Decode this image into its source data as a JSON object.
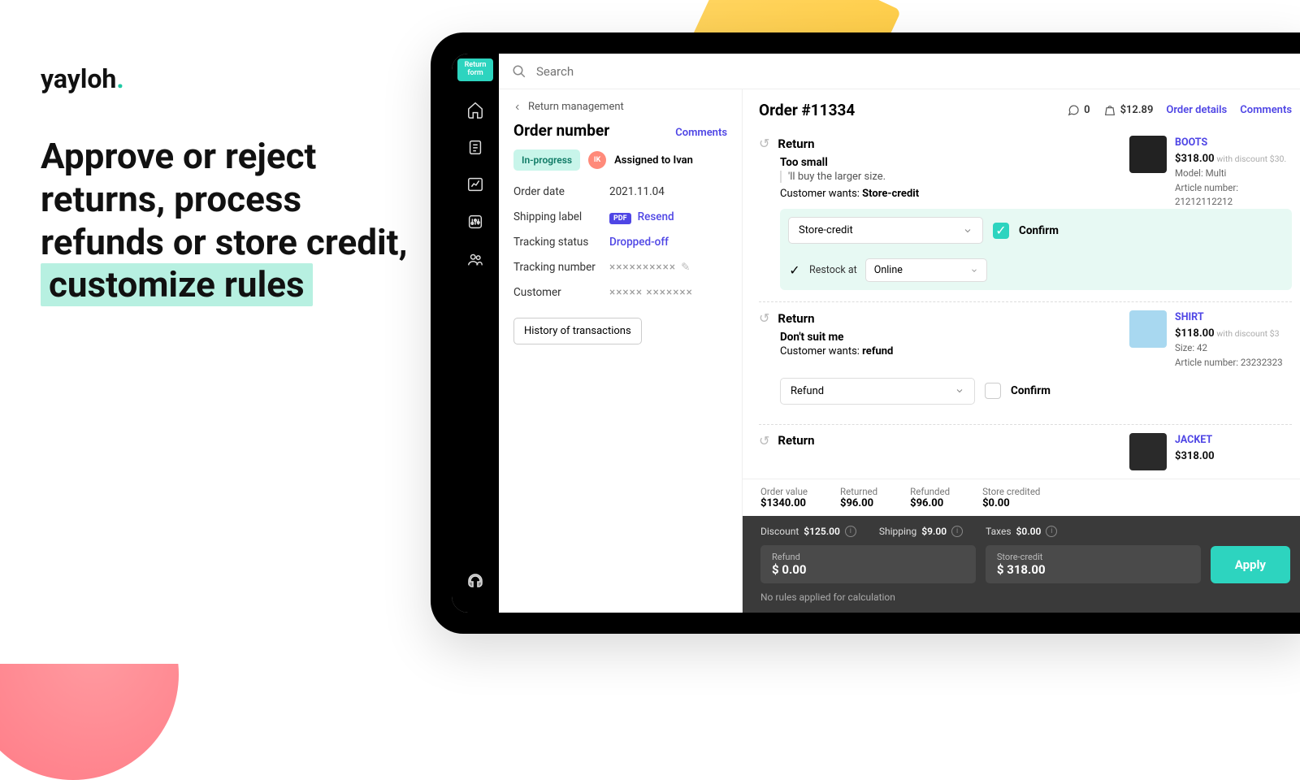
{
  "hero": {
    "brand": "yayloh",
    "tagline_part1": "Approve or reject returns, process refunds or store credit, ",
    "tagline_highlight": "customize rules"
  },
  "sidebar": {
    "return_form_label": "Return form"
  },
  "search": {
    "placeholder": "Search"
  },
  "left_panel": {
    "breadcrumb": "Return management",
    "title": "Order number",
    "comments_link": "Comments",
    "status": "In-progress",
    "assignee_initials": "IK",
    "assigned_text": "Assigned to Ivan",
    "fields": {
      "order_date_label": "Order date",
      "order_date_value": "2021.11.04",
      "shipping_label_label": "Shipping label",
      "shipping_pdf": "PDF",
      "shipping_resend": "Resend",
      "tracking_status_label": "Tracking status",
      "tracking_status_value": "Dropped-off",
      "tracking_number_label": "Tracking number",
      "tracking_number_value": "××××××××××",
      "customer_label": "Customer",
      "customer_value": "××××× ×××××××"
    },
    "history_btn": "History of transactions"
  },
  "right_panel": {
    "order_title": "Order #11334",
    "comment_count": "0",
    "weight_price": "$12.89",
    "order_details_link": "Order details",
    "comments_link": "Comments",
    "returns": [
      {
        "title": "Return",
        "reason": "Too small",
        "note": "'ll buy the larger size.",
        "wants_label": "Customer wants: ",
        "wants_value": "Store-credit",
        "action_selected": "Store-credit",
        "confirm_label": "Confirm",
        "confirmed": true,
        "restock_label": "Restock at",
        "restock_value": "Online",
        "product": {
          "name": "BOOTS",
          "price": "$318.00",
          "discount": "with discount $30.",
          "model": "Model: Multi",
          "article": "Article number: 21212112212"
        }
      },
      {
        "title": "Return",
        "reason": "Don't suit me",
        "wants_label": "Customer wants: ",
        "wants_value": "refund",
        "action_selected": "Refund",
        "confirm_label": "Confirm",
        "confirmed": false,
        "product": {
          "name": "SHIRT",
          "price": "$118.00",
          "discount": "with discount $3",
          "size": "Size: 42",
          "article": "Article number: 23232323"
        }
      },
      {
        "title": "Return",
        "product": {
          "name": "JACKET",
          "price": "$318.00"
        }
      }
    ]
  },
  "footer": {
    "totals": {
      "order_value_label": "Order value",
      "order_value": "$1340.00",
      "returned_label": "Returned",
      "returned": "$96.00",
      "refunded_label": "Refunded",
      "refunded": "$96.00",
      "store_credited_label": "Store credited",
      "store_credited": "$0.00"
    },
    "dark": {
      "discount_label": "Discount",
      "discount": "$125.00",
      "shipping_label": "Shipping",
      "shipping": "$9.00",
      "taxes_label": "Taxes",
      "taxes": "$0.00",
      "refund_box_label": "Refund",
      "refund_box_value": "$ 0.00",
      "storecredit_box_label": "Store-credit",
      "storecredit_box_value": "$ 318.00",
      "apply": "Apply",
      "rules_note": "No rules applied for calculation"
    }
  }
}
